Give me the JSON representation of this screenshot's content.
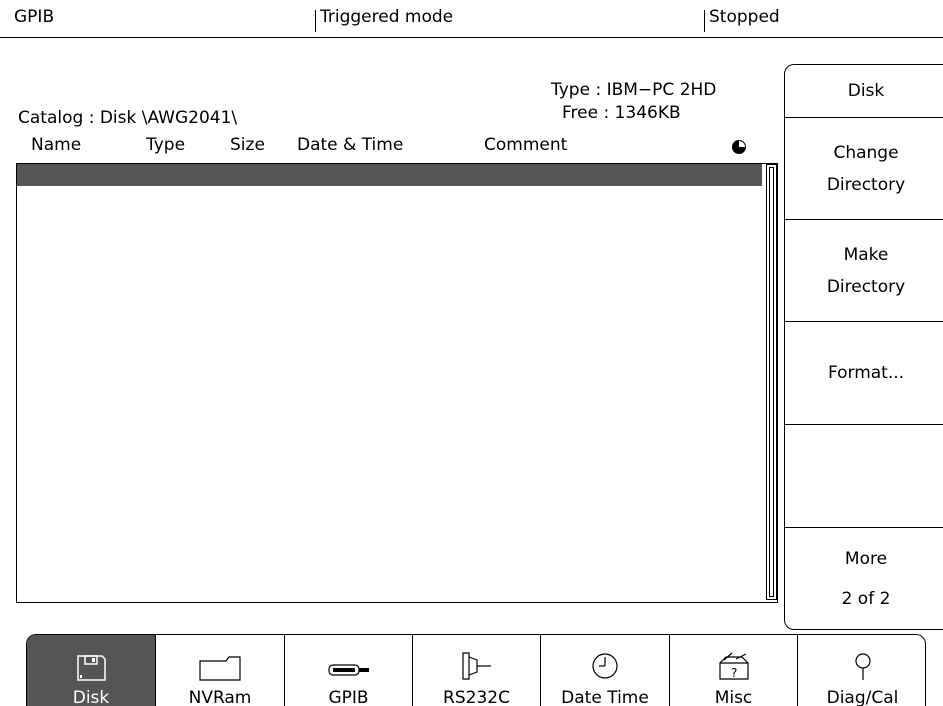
{
  "status_bar": {
    "interface": "GPIB",
    "mode": "Triggered mode",
    "run_state": "Stopped"
  },
  "catalog": {
    "label": "Catalog : Disk   \\AWG2041\\",
    "type": "Type : IBM−PC 2HD",
    "free": "Free : 1346KB"
  },
  "columns": {
    "name": "Name",
    "type": "Type",
    "size": "Size",
    "datetime": "Date & Time",
    "comment": "Comment"
  },
  "side_menu": {
    "disk": "Disk",
    "change_dir_1": "Change",
    "change_dir_2": "Directory",
    "make_dir_1": "Make",
    "make_dir_2": "Directory",
    "format": "Format...",
    "more": "More",
    "page": "2 of 2"
  },
  "bottom_menu": {
    "disk": "Disk",
    "nvram": "NVRam",
    "gpib": "GPIB",
    "rs232c": "RS232C",
    "date_time": "Date Time",
    "misc": "Misc",
    "diag_cal": "Diag/Cal"
  },
  "icons": {
    "list_indicator": "pie-disc-icon",
    "disk": "floppy-icon",
    "nvram": "folder-icon",
    "gpib": "gpib-connector-icon",
    "rs232c": "serial-connector-icon",
    "date_time": "clock-icon",
    "misc": "toolbox-icon",
    "diag_cal": "probe-icon"
  }
}
